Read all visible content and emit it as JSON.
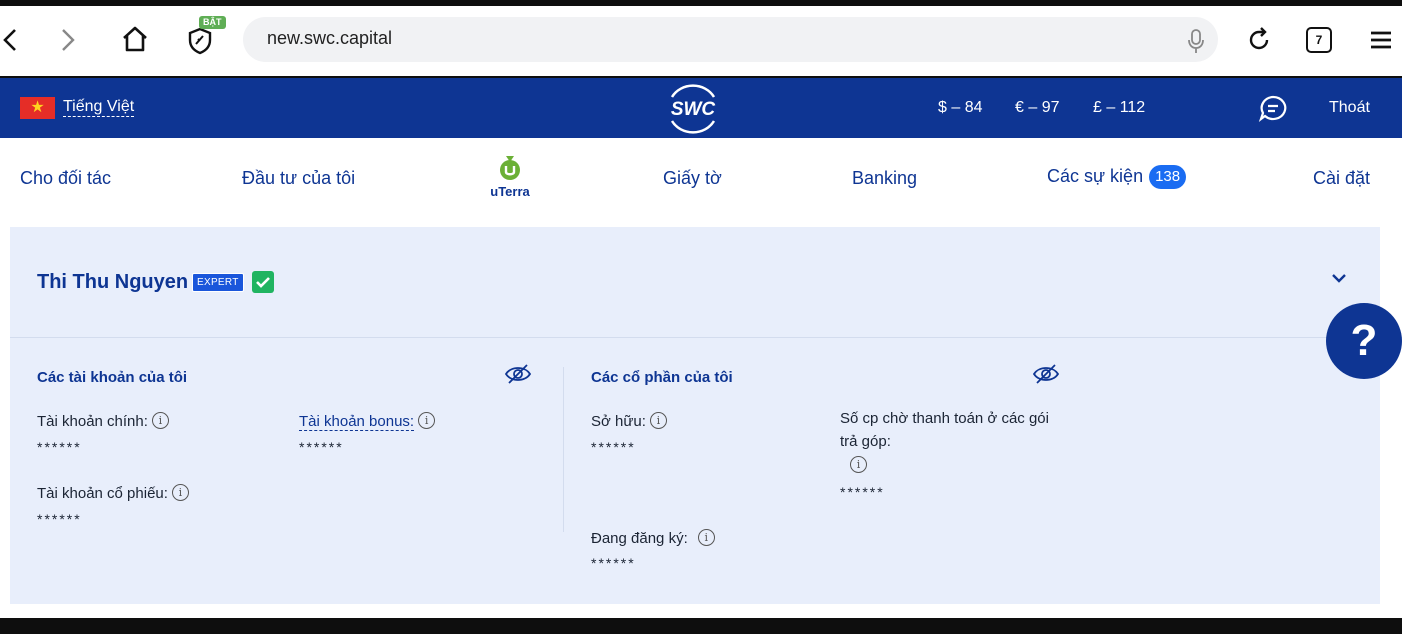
{
  "browser": {
    "url": "new.swc.capital",
    "shield_badge": "BẬT",
    "tab_count": "7"
  },
  "topbar": {
    "language": "Tiếng Việt",
    "logo": "SWC",
    "currencies": [
      "$ – 84",
      "€ – 97",
      "£ – 112"
    ],
    "logout": "Thoát"
  },
  "nav": {
    "items": [
      "Cho đối tác",
      "Đầu tư của tôi",
      "Giấy tờ",
      "Banking",
      "Các sự kiện",
      "Cài đặt"
    ],
    "events_count": "138",
    "uterra_label": "uTerra"
  },
  "profile": {
    "name": "Thi Thu Nguyen",
    "badge": "EXPERT",
    "verified": true
  },
  "accounts": {
    "title": "Các tài khoản của tôi",
    "main_label": "Tài khoản chính:",
    "main_value": "******",
    "bonus_label": "Tài khoản bonus:",
    "bonus_value": "******",
    "stock_label": "Tài khoản cổ phiếu:",
    "stock_value": "******"
  },
  "shares": {
    "title": "Các cổ phần của tôi",
    "owned_label": "Sở hữu:",
    "owned_value": "******",
    "pending_label_1": "Số cp chờ thanh toán ở các gói",
    "pending_label_2": "trả góp:",
    "pending_value": "******",
    "registered_label": "Đang đăng ký:",
    "registered_value": "******"
  },
  "help_button": "?",
  "colors": {
    "brand_navy": "#0e3593",
    "badge_blue": "#1a6cf2",
    "verified_green": "#20b461",
    "panel_bg": "#e8eefb"
  }
}
